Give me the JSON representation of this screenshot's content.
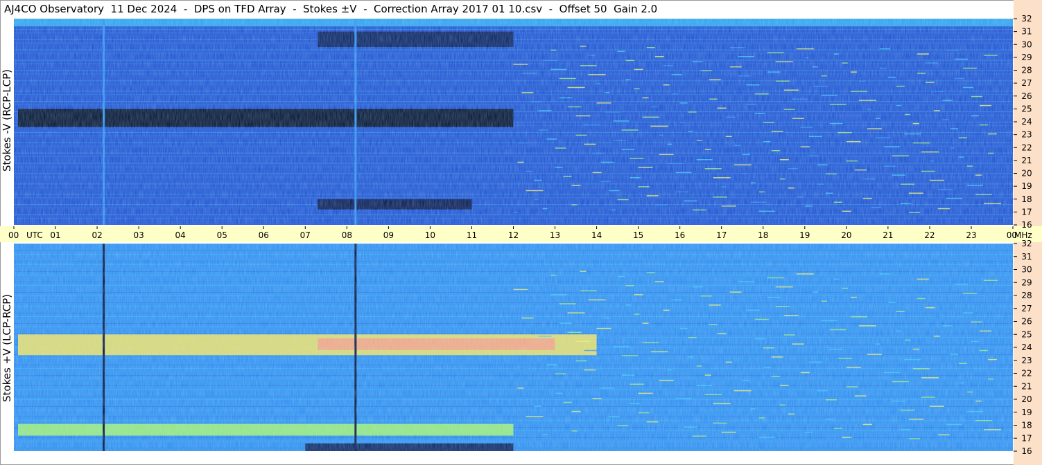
{
  "title": "AJ4CO Observatory  11 Dec 2024  -  DPS on TFD Array  -  Stokes ±V  -  Correction Array 2017 01 10.csv  -  Offset 50  Gain 2.0",
  "chart_data": [
    {
      "type": "heatmap",
      "panel": "top",
      "ylabel": "Stokes -V (RCP-LCP)",
      "xlabel": "UTC",
      "x_unit": "UTC",
      "y_unit": "MHz",
      "xlim": [
        0,
        24
      ],
      "ylim": [
        16,
        32
      ],
      "time_ticks": [
        "00",
        "01",
        "02",
        "03",
        "04",
        "05",
        "06",
        "07",
        "08",
        "09",
        "10",
        "11",
        "12",
        "13",
        "14",
        "15",
        "16",
        "17",
        "18",
        "19",
        "20",
        "21",
        "22",
        "23",
        "00"
      ],
      "freq_ticks": [
        16,
        17,
        18,
        19,
        20,
        21,
        22,
        23,
        24,
        25,
        26,
        27,
        28,
        29,
        30,
        31,
        32
      ],
      "colormap": [
        "#000010",
        "#0a1f7a",
        "#1c4fd0",
        "#2d8ef0",
        "#38c8f8",
        "#9ef070",
        "#f8f060",
        "#f8a080",
        "#f06060"
      ],
      "base_color": "#1c4fd0",
      "bands": [
        {
          "f1": 23.6,
          "f2": 25.0,
          "color": "#000818",
          "t1": 0.1,
          "t2": 12.0
        },
        {
          "f1": 29.8,
          "f2": 31.0,
          "color": "#061850",
          "t1": 7.3,
          "t2": 12.0
        },
        {
          "f1": 17.2,
          "f2": 18.0,
          "color": "#050f40",
          "t1": 7.3,
          "t2": 11.0
        },
        {
          "f1": 31.4,
          "f2": 32.0,
          "color": "#30a8f0",
          "t1": 0.0,
          "t2": 24.0
        }
      ],
      "vertical_streaks": [
        {
          "t": 2.15,
          "color": "#2d8ef0"
        },
        {
          "t": 8.2,
          "color": "#2d8ef0"
        }
      ]
    },
    {
      "type": "heatmap",
      "panel": "bottom",
      "ylabel": "Stokes +V (LCP-RCP)",
      "xlabel": "UTC",
      "x_unit": "UTC",
      "y_unit": "MHz",
      "xlim": [
        0,
        24
      ],
      "ylim": [
        16,
        32
      ],
      "time_ticks": [
        "00",
        "01",
        "02",
        "03",
        "04",
        "05",
        "06",
        "07",
        "08",
        "09",
        "10",
        "11",
        "12",
        "13",
        "14",
        "15",
        "16",
        "17",
        "18",
        "19",
        "20",
        "21",
        "22",
        "23",
        "00"
      ],
      "freq_ticks": [
        16,
        17,
        18,
        19,
        20,
        21,
        22,
        23,
        24,
        25,
        26,
        27,
        28,
        29,
        30,
        31,
        32
      ],
      "colormap": [
        "#000010",
        "#0a1f7a",
        "#1c4fd0",
        "#2d8ef0",
        "#38c8f8",
        "#9ef070",
        "#f8f060",
        "#f8a080",
        "#f06060"
      ],
      "base_color": "#2d8ef0",
      "bands": [
        {
          "f1": 23.4,
          "f2": 25.0,
          "color": "#f0e060",
          "t1": 0.1,
          "t2": 14.0
        },
        {
          "f1": 23.8,
          "f2": 24.7,
          "color": "#f8a080",
          "t1": 7.3,
          "t2": 13.0
        },
        {
          "f1": 17.2,
          "f2": 18.1,
          "color": "#9ef070",
          "t1": 0.1,
          "t2": 12.0
        },
        {
          "f1": 16.0,
          "f2": 16.6,
          "color": "#061850",
          "t1": 7.0,
          "t2": 12.0
        }
      ],
      "vertical_streaks": [
        {
          "t": 2.15,
          "color": "#04103a"
        },
        {
          "t": 8.2,
          "color": "#04103a"
        }
      ]
    }
  ],
  "axis_labels": {
    "time_label": "UTC",
    "freq_unit": "MHz"
  },
  "colors": {
    "axis_band": "#ffffc8",
    "right_axis_band": "#fde0c8"
  }
}
